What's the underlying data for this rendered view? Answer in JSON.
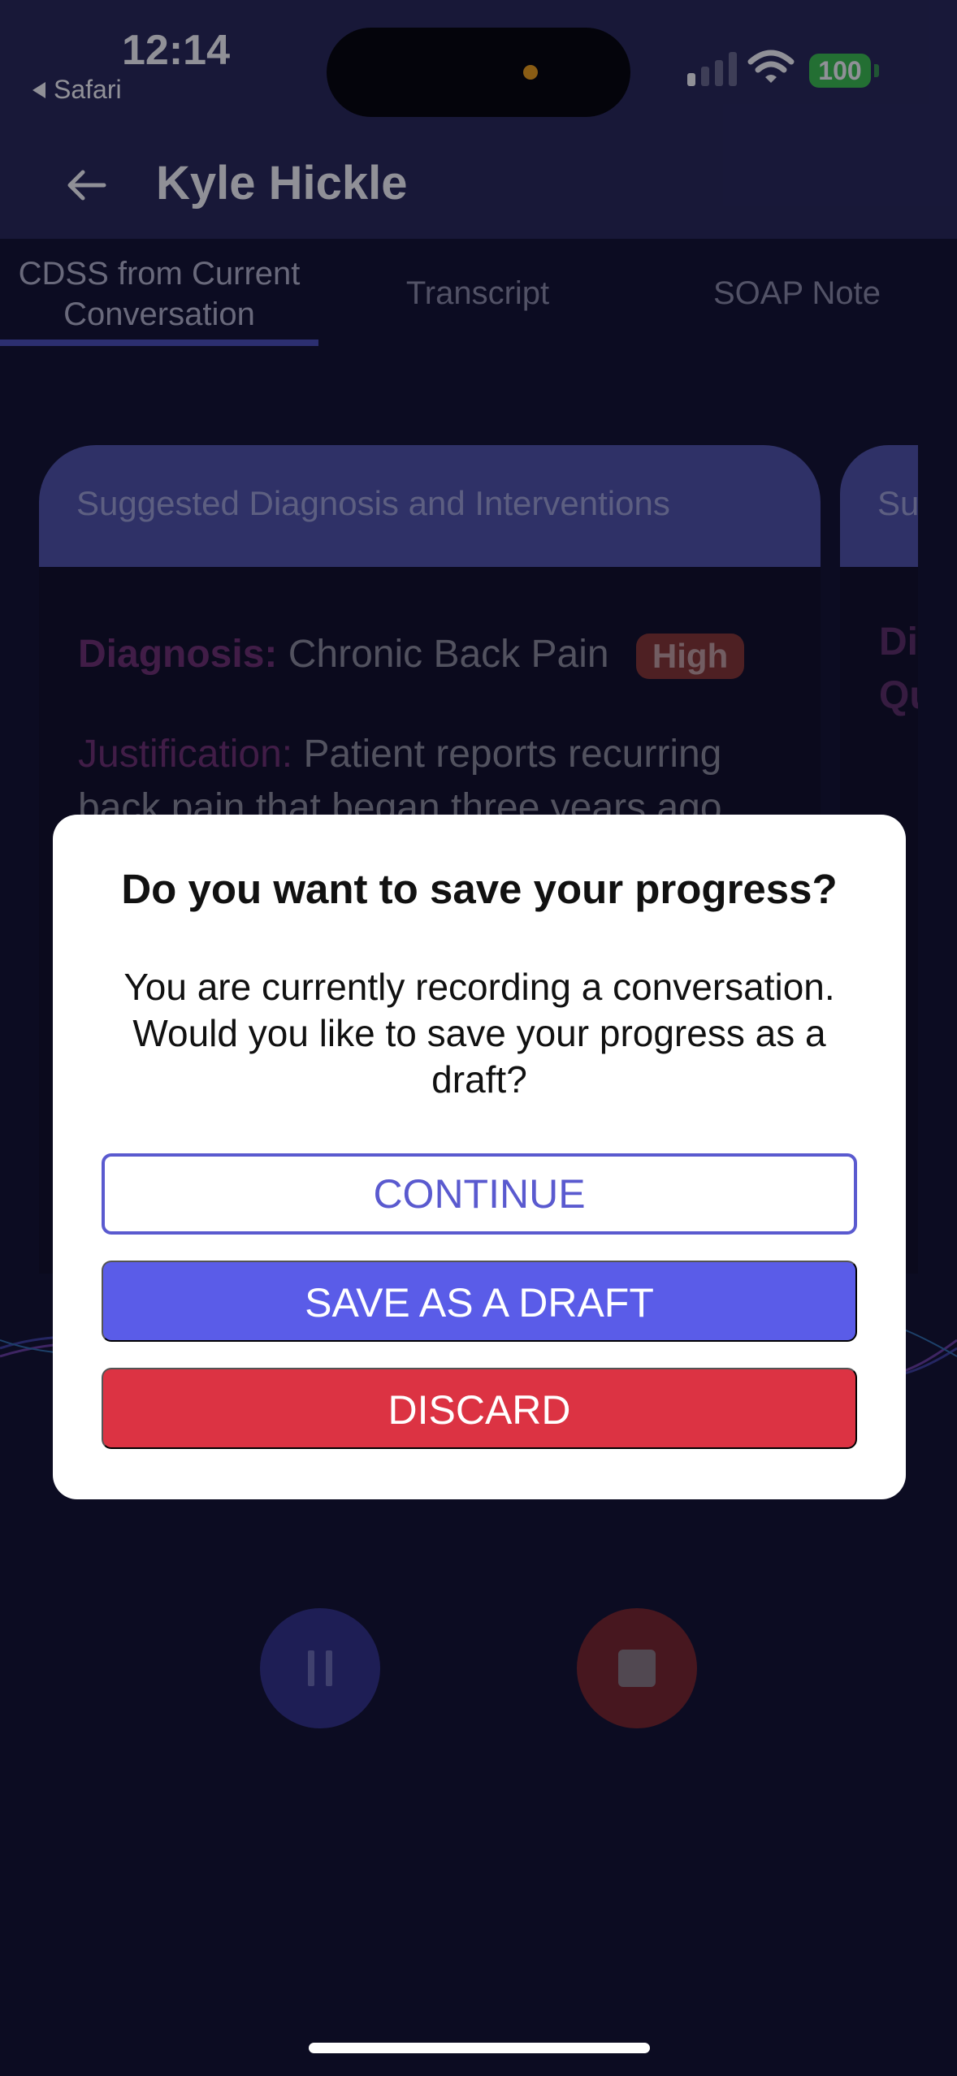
{
  "status_bar": {
    "time": "12:14",
    "back_app": "Safari",
    "battery": "100"
  },
  "header": {
    "title": "Kyle Hickle"
  },
  "tabs": [
    {
      "label": "CDSS from Current Conversation",
      "line1": "CDSS from Current",
      "line2": "Conversation",
      "active": true
    },
    {
      "label": "Transcript",
      "active": false
    },
    {
      "label": "SOAP Note",
      "active": false
    }
  ],
  "card": {
    "title": "Suggested Diagnosis and Interventions",
    "side_title": "Su",
    "diagnosis_label": "Diagnosis:",
    "diagnosis_value": "Chronic Back Pain",
    "severity": "High",
    "justification_label": "Justification:",
    "justification_line1": "Patient reports recurring",
    "justification_line2": "back pain that began three years ago",
    "side_line1": "Di",
    "side_line2": "Qu"
  },
  "dialog": {
    "title": "Do you want to save your progress?",
    "message": "You are currently recording a conversation. Would you like to save your progress as a draft?",
    "continue_label": "CONTINUE",
    "draft_label": "SAVE AS A DRAFT",
    "discard_label": "DISCARD"
  },
  "colors": {
    "header_bg": "#262653",
    "accent": "#5a5ce8",
    "danger": "#dc3343",
    "badge": "#87342c"
  }
}
